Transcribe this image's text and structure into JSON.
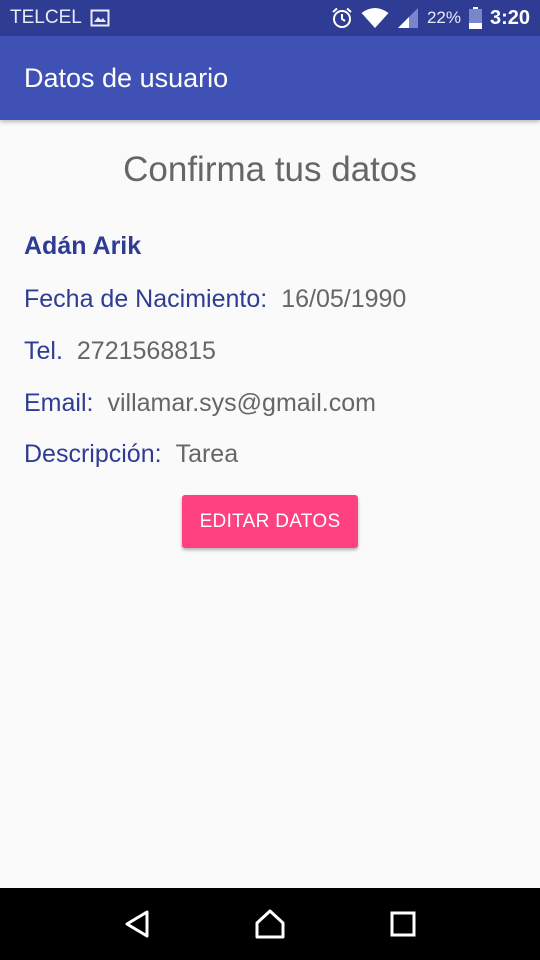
{
  "status_bar": {
    "carrier": "TELCEL",
    "battery_percent": "22%",
    "time": "3:20",
    "icons": [
      "image-icon",
      "alarm-icon",
      "wifi-icon",
      "signal-icon",
      "battery-icon"
    ]
  },
  "app_bar": {
    "title": "Datos de usuario"
  },
  "content": {
    "heading": "Confirma tus datos",
    "name": "Adán Arik",
    "birth_label": "Fecha de Nacimiento:",
    "birth_value": "16/05/1990",
    "tel_label": "Tel.",
    "tel_value": "2721568815",
    "email_label": "Email:",
    "email_value": "villamar.sys@gmail.com",
    "desc_label": "Descripción:",
    "desc_value": "Tarea",
    "edit_button_label": "EDITAR DATOS"
  },
  "nav_bar": {
    "icons": [
      "back-icon",
      "home-icon",
      "recents-icon"
    ]
  },
  "colors": {
    "status_bar": "#2f3c93",
    "app_bar": "#3f51b5",
    "label": "#2f3c93",
    "value": "#666666",
    "accent": "#ff4081",
    "background": "#fafafa"
  }
}
